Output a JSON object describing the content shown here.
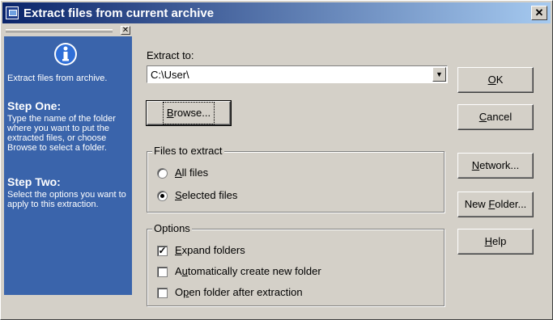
{
  "window": {
    "title": "Extract files from current archive",
    "close_glyph": "✕"
  },
  "sidepane": {
    "close_glyph": "✕",
    "intro": "Extract files from archive.",
    "step1_title": "Step One:",
    "step1_text": "Type the name of the folder where you want to put the extracted files, or choose Browse to select a folder.",
    "step2_title": "Step Two:",
    "step2_text": "Select the options you want to apply to this extraction."
  },
  "extract_to": {
    "label": "Extract to:",
    "value": "C:\\User\\",
    "arrow": "▼"
  },
  "buttons": {
    "browse": {
      "label": "Browse...",
      "mnemonic": "B",
      "rest": "rowse..."
    },
    "ok": {
      "mnemonic": "O",
      "rest": "K"
    },
    "cancel": {
      "mnemonic": "C",
      "rest": "ancel"
    },
    "network": {
      "mnemonic": "N",
      "rest": "etwork..."
    },
    "new_folder": {
      "pre": "New ",
      "mnemonic": "F",
      "rest": "older..."
    },
    "help": {
      "mnemonic": "H",
      "rest": "elp"
    }
  },
  "files_group": {
    "title": "Files to extract",
    "all_files": {
      "mnemonic": "A",
      "rest": "ll files",
      "selected": false
    },
    "selected_files": {
      "mnemonic": "S",
      "rest": "elected files",
      "selected": true
    }
  },
  "options_group": {
    "title": "Options",
    "expand": {
      "mnemonic": "E",
      "rest": "xpand folders",
      "checked": true
    },
    "auto_create": {
      "pre": "A",
      "mnemonic": "u",
      "rest": "tomatically create new folder",
      "checked": false
    },
    "open_after": {
      "pre": "O",
      "mnemonic": "p",
      "rest": "en folder after extraction",
      "checked": false
    }
  },
  "check_glyph": "✓"
}
